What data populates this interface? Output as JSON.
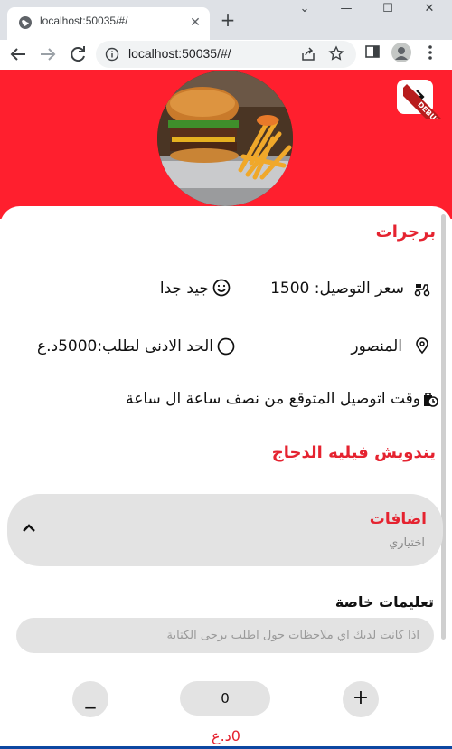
{
  "browser": {
    "tab_title": "localhost:50035/#/",
    "tab_close": "✕",
    "new_tab": "+",
    "url": "localhost:50035/#/",
    "window_controls": [
      "⌄",
      "—",
      "☐",
      "✕"
    ]
  },
  "app": {
    "debug_banner": "DEBUG",
    "restaurant_name": "برجرات",
    "delivery_price": "سعر التوصيل: 1500",
    "rating_text": "جيد جدا",
    "location": "المنصور",
    "min_order": "الحد الادنى لطلب:5000د.ع",
    "delivery_time": "وقت اتوصيل المتوقع من نصف ساعة ال ساعة",
    "item_name": "يندويش فيليه الدجاج",
    "addons_title": "اضافات",
    "addons_subtitle": "اختياري",
    "notes_label": "تعليمات خاصة",
    "notes_placeholder": "اذا كانت لديك اي ملاحظات حول اطلب يرجى الكتابة",
    "qty_minus": "_",
    "qty_value": "0",
    "qty_plus": "+",
    "price": "0د.ع",
    "accent_color": "#e52330",
    "hero_color": "#ff1f2e"
  }
}
